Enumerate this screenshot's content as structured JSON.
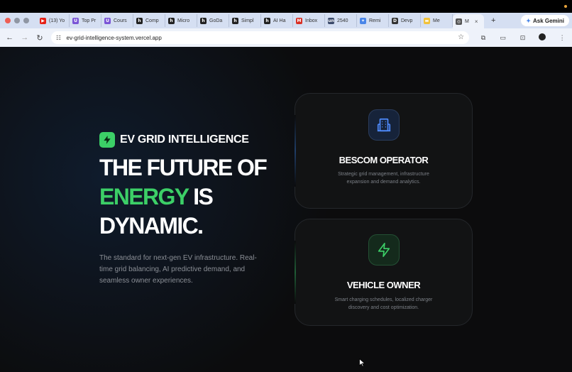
{
  "browser": {
    "tabs": [
      {
        "title": "(13) Yo",
        "icon": "youtube-icon",
        "color": "#e62117",
        "glyph": "▶"
      },
      {
        "title": "Top Pr",
        "icon": "site-icon",
        "color": "#7a55d6",
        "glyph": "U"
      },
      {
        "title": "Cours",
        "icon": "site-icon",
        "color": "#7a55d6",
        "glyph": "U"
      },
      {
        "title": "Comp",
        "icon": "site-icon",
        "color": "#222222",
        "glyph": "h"
      },
      {
        "title": "Micro",
        "icon": "site-icon",
        "color": "#222222",
        "glyph": "h"
      },
      {
        "title": "GoDa",
        "icon": "site-icon",
        "color": "#222222",
        "glyph": "h"
      },
      {
        "title": "Simpl",
        "icon": "site-icon",
        "color": "#222222",
        "glyph": "h"
      },
      {
        "title": "AI Ha",
        "icon": "site-icon",
        "color": "#222222",
        "glyph": "h"
      },
      {
        "title": "Inbox",
        "icon": "gmail-icon",
        "color": "#d93025",
        "glyph": "M"
      },
      {
        "title": "2540",
        "icon": "site-icon",
        "color": "#3b4a6b",
        "glyph": "un"
      },
      {
        "title": "Remi",
        "icon": "site-icon",
        "color": "#4a86e8",
        "glyph": "✦"
      },
      {
        "title": "Devp",
        "icon": "site-icon",
        "color": "#333333",
        "glyph": "D"
      },
      {
        "title": "Me",
        "icon": "site-icon",
        "color": "#f2c23a",
        "glyph": "▬"
      },
      {
        "title": "M",
        "icon": "globe-icon",
        "color": "#555555",
        "glyph": "◎",
        "active": true
      }
    ],
    "ask_gemini": "Ask Gemini",
    "url": "ev-grid-intelligence-system.vercel.app"
  },
  "hero": {
    "brand_name": "EV GRID INTELLIGENCE",
    "headline_line1": "THE FUTURE OF",
    "headline_green": "ENERGY",
    "headline_is": " IS",
    "headline_line3": "DYNAMIC.",
    "description": "The standard for next-gen EV infrastructure. Real-time grid balancing, AI predictive demand, and seamless owner experiences."
  },
  "cards": [
    {
      "title": "BESCOM OPERATOR",
      "description": "Strategic grid management, infrastructure expansion and demand analytics.",
      "icon": "building-icon",
      "accent": "#4f8cff"
    },
    {
      "title": "VEHICLE OWNER",
      "description": "Smart charging schedules, localized charger discovery and cost optimization.",
      "icon": "lightning-icon",
      "accent": "#3ccf67"
    }
  ],
  "colors": {
    "accent_green": "#3ccf67",
    "background": "#0c0c0d",
    "card_background": "#121314"
  }
}
